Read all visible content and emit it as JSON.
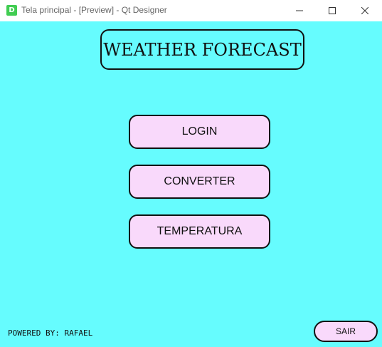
{
  "window": {
    "icon_letter": "D",
    "title": "Tela principal - [Preview] - Qt Designer"
  },
  "main": {
    "heading": "WEATHER FORECAST",
    "buttons": [
      {
        "label": "LOGIN"
      },
      {
        "label": "CONVERTER"
      },
      {
        "label": "TEMPERATURA"
      }
    ],
    "footer_text": "POWERED BY: RAFAEL",
    "exit_label": "SAIR"
  },
  "colors": {
    "background": "#66fcfe",
    "button_fill": "#f9d9fb",
    "border": "#111111",
    "app_icon": "#41cd52"
  },
  "icons": {
    "minimize": "minimize-icon",
    "maximize": "maximize-icon",
    "close": "close-icon"
  }
}
